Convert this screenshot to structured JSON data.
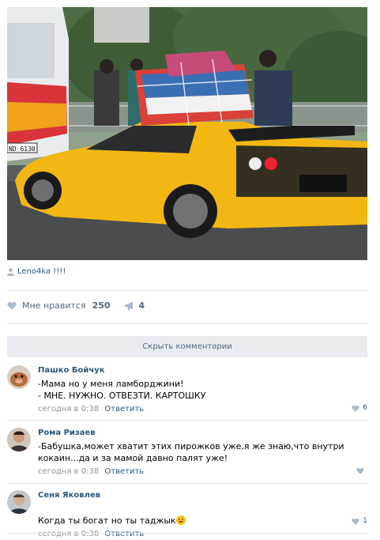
{
  "post": {
    "author": "Leno4ka !!!!",
    "likes_label": "Мне нравится",
    "likes_count": "250",
    "shares_count": "4"
  },
  "hide_comments_label": "Скрыть комментарии",
  "comments": [
    {
      "name": "Пашко Бойчук",
      "text": "-Мама но у меня ламборджини!\n- МНЕ. НУЖНО. ОТВЕЗТИ. КАРТОШКУ",
      "time": "сегодня в 0:38",
      "reply": "Ответить",
      "likes": "6"
    },
    {
      "name": "Рома Ризаев",
      "text": "-Бабушка,может хватит этих пирожков уже,я же знаю,что внутри\nкокаин...да и за мамой давно палят уже!",
      "time": "сегодня в 0:38",
      "reply": "Ответить",
      "likes": ""
    },
    {
      "name": "Сеня Яковлев",
      "text": "Когда ты богат но ты таджык",
      "time": "сегодня в 0:38",
      "reply": "Ответить",
      "likes": "1"
    }
  ],
  "photo": {
    "bus_sign": "ND 6130"
  },
  "colors": {
    "link": "#2b587a",
    "muted": "#55677d",
    "divider": "#e7e8ec",
    "button_bg": "#e8ecf1",
    "car_yellow": "#f2b713"
  },
  "icons": [
    "user-icon",
    "heart-icon",
    "megaphone-icon",
    "smile-emoji-icon"
  ]
}
